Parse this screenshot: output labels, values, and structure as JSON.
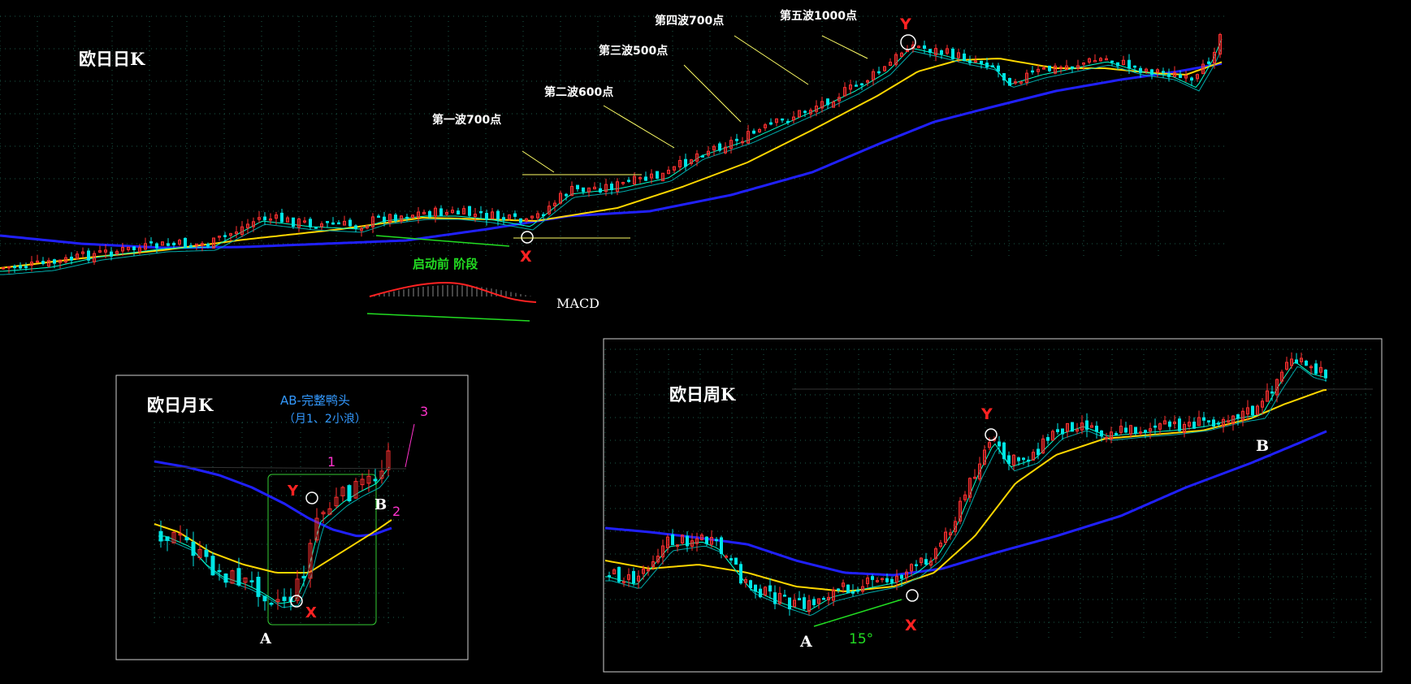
{
  "chart_data": [
    {
      "type": "candlestick",
      "title": "欧日日K",
      "annotations": {
        "wave1": "第一波700点",
        "wave2": "第二波600点",
        "wave3": "第三波500点",
        "wave4": "第四波700点",
        "wave5": "第五波1000点",
        "pre_stage": "启动前 阶段",
        "macd": "MACD",
        "point_x": "X",
        "point_y": "Y"
      },
      "colors": {
        "up": "#ff3030",
        "down": "#00e5e5",
        "ma_fast": "#00ffcc",
        "ma_mid": "#00aaaa",
        "ma_yellow": "#ffd700",
        "ma_long": "#2020ff",
        "annotation": "#ffff66",
        "green_text": "#22dd22"
      }
    },
    {
      "type": "candlestick",
      "title": "欧日月K",
      "annotations": {
        "ab": "AB-完整鸭头",
        "ab_sub": "（月1、2小浪）",
        "n1": "1",
        "n2": "2",
        "n3": "3",
        "point_a": "A",
        "point_b": "B",
        "point_x": "X",
        "point_y": "Y"
      },
      "colors": {
        "ab_text": "#3399ff",
        "numbers": "#ff33cc",
        "box": "#33cc33"
      }
    },
    {
      "type": "candlestick",
      "title": "欧日周K",
      "annotations": {
        "point_a": "A",
        "point_b": "B",
        "point_x": "X",
        "point_y": "Y",
        "angle": "15°"
      },
      "colors": {
        "angle_text": "#22dd22"
      }
    }
  ]
}
